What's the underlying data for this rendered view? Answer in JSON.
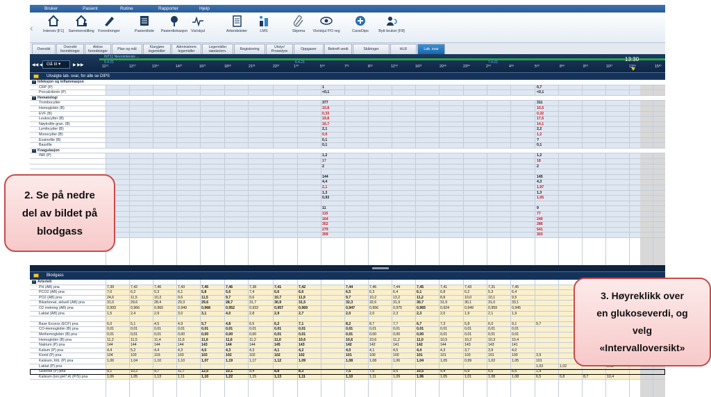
{
  "menu": [
    "Bruker",
    "Pasient",
    "Rutine",
    "Rapporter",
    "Hjelp"
  ],
  "toolbar": [
    "Intensiv [F1]",
    "Sammenstilling",
    "Forordninger",
    "Pasientliste",
    "Pasientlokasjon",
    "Vis/skjul",
    "Arbeidslister",
    "LMS",
    "Skjema",
    "Vis/skjul PO reg",
    "CaveDips",
    "Bytt bruker [F8]"
  ],
  "tabs": [
    "Oversikt",
    "Oversikt forordninger",
    "Aktive forordninger",
    "Plan og mål",
    "Klargjøre legemidler",
    "Administrere legemidler",
    "Legemidler væske/ern.",
    "Registrering",
    "Utstyr/ Prosedyre",
    "Oppgaver",
    "Bekreft verdi",
    "Skåringer",
    "HLR",
    "Lab. svar"
  ],
  "timeline": {
    "goto": "Gå til",
    "ward": "INT11 Nevrointensiv ...",
    "now": "13:30",
    "date1": "5.4.21",
    "date2": "6.4.21",
    "date3": "7.4.21",
    "ticks": [
      "11⁵¹",
      "12⁰⁷",
      "13¹⁴",
      "14³⁷",
      "16²⁷",
      "18²⁸",
      "21²³",
      "23³⁷",
      "1⁴⁰",
      "5⁰⁰",
      "7⁰¹",
      "8⁵²",
      "12⁴²",
      "16²³",
      "20⁰⁶",
      "23³⁴",
      "2⁰⁰",
      "4⁵⁶",
      "5⁰⁰",
      "8⁰⁶",
      "8⁵⁰",
      "10¹⁷",
      "13⁰⁰",
      "15³⁰"
    ]
  },
  "upper": {
    "title": "Utvalgte lab. svar, for alle se DIPS",
    "rows": [
      {
        "name": "Infeksjon og inflammasjon",
        "group": true
      },
      {
        "name": "CRP (P)",
        "a": "1",
        "b": "0,7"
      },
      {
        "name": "Procalcitonin (P)",
        "a": "<0,1",
        "b": "<0,1"
      },
      {
        "name": "Hematologi",
        "group": true
      },
      {
        "name": "Trombocytter",
        "a": "377",
        "b": "311"
      },
      {
        "name": "Hemoglobin (B)",
        "a": "10,8",
        "b": "10,5",
        "red": true
      },
      {
        "name": "EVF (B)",
        "a": "0,33",
        "b": "0,32",
        "red": true
      },
      {
        "name": "Leukocytter (B)",
        "a": "19,8",
        "b": "17,5",
        "red": true
      },
      {
        "name": "Nøytrofile gran. (B)",
        "a": "16,7",
        "b": "14,1",
        "red": true
      },
      {
        "name": "Lymfocytter (B)",
        "a": "2,1",
        "b": "2,2"
      },
      {
        "name": "Monocytter (B)",
        "a": "0,9",
        "b": "1,2",
        "red": true
      },
      {
        "name": "Eosinofile (B)",
        "a": "0,1",
        "b": "?"
      },
      {
        "name": "Basofile",
        "a": "0,1",
        "b": "0,1"
      },
      {
        "name": "Koagulasjon",
        "group": true
      },
      {
        "name": "INR (P)",
        "a": "1,2",
        "b": "1,2"
      },
      {
        "name": "",
        "a": "17",
        "b": "18",
        "red": true
      },
      {
        "name": "",
        "a": "2",
        "b": "2"
      },
      {
        "name": "",
        "a": "",
        "b": ""
      },
      {
        "name": "",
        "a": "144",
        "b": "145"
      },
      {
        "name": "",
        "a": "4,4",
        "b": "4,3"
      },
      {
        "name": "",
        "a": "2,1",
        "b": "1,97",
        "red": true
      },
      {
        "name": "",
        "a": "1,3",
        "b": "1,3"
      },
      {
        "name": "",
        "a": "0,93",
        "b": "1,05",
        "redb": true
      },
      {
        "name": "",
        "a": "",
        "b": ""
      },
      {
        "name": "",
        "a": "11",
        "b": "9"
      },
      {
        "name": "",
        "a": "115",
        "b": "77",
        "red": true
      },
      {
        "name": "",
        "a": "164",
        "b": "240",
        "red": true
      },
      {
        "name": "",
        "a": "352",
        "b": "286",
        "red": true
      },
      {
        "name": "(P)",
        "a": "279",
        "b": "541",
        "red": true
      },
      {
        "name": "Pankreasamylase (P)",
        "a": "359",
        "b": "303",
        "red": true
      }
    ]
  },
  "bloodgas": {
    "title": "Blodgass",
    "rows": [
      {
        "name": "Arterielt",
        "group": true
      },
      {
        "name": "PH (AB) pna",
        "v": [
          "7,39",
          "7,42",
          "7,46",
          "7,43",
          "7,45",
          "7,46",
          "7,38",
          "7,41",
          "7,42",
          "",
          "7,44",
          "7,46",
          "7,44",
          "7,45",
          "7,41",
          "7,43",
          "7,31",
          "7,45"
        ]
      },
      {
        "name": "PCO2 (AB) pna",
        "v": [
          "7,0",
          "6,2",
          "5,3",
          "6,1",
          "5,8",
          "5,6",
          "7,4",
          "6,6",
          "6,6",
          "",
          "6,5",
          "6,3",
          "6,4",
          "6,1",
          "6,8",
          "6,2",
          "5,3",
          "6,4"
        ]
      },
      {
        "name": "PO2 (AB) pna",
        "v": [
          "24,6",
          "11,5",
          "10,3",
          "9,6",
          "11,5",
          "9,7",
          "9,6",
          "10,7",
          "11,9",
          "",
          "9,7",
          "10,2",
          "13,2",
          "11,2",
          "8,8",
          "10,0",
          "10,1",
          "9,5"
        ]
      },
      {
        "name": "Bikarbonat, aktuell (AB) pna",
        "v": [
          "31,0",
          "29,6",
          "28,4",
          "29,3",
          "29,6",
          "28,7",
          "31,7",
          "30,9",
          "31,5",
          "",
          "32,3",
          "32,6",
          "31,9",
          "30,7",
          "31,9",
          "30,1",
          "31,0",
          "33,1"
        ]
      },
      {
        "name": "O2 metning (AB) pna",
        "v": [
          "0,993",
          "0,966",
          "0,960",
          "0,949",
          "0,968",
          "0,952",
          "0,933",
          "0,957",
          "0,969",
          "",
          "0,947",
          "0,956",
          "0,975",
          "0,965",
          "0,924",
          "0,949",
          "0,959",
          "0,945"
        ]
      },
      {
        "name": "Laktat (AB) pna",
        "v": [
          "1,5",
          "2,4",
          "2,9",
          "3,0",
          "3,1",
          "4,0",
          "2,8",
          "2,9",
          "2,7",
          "",
          "2,0",
          "2,0",
          "2,3",
          "2,3",
          "2,0",
          "1,9",
          "2,1",
          "1,9"
        ]
      },
      {
        "name": "",
        "v": []
      },
      {
        "name": "Base Excess (ECF) pna",
        "v": [
          "6,0",
          "5,1",
          "4,5",
          "4,9",
          "5,7",
          "4,8",
          "6,5",
          "6,2",
          "7,1",
          "",
          "8,2",
          "8,7",
          "7,7",
          "6,7",
          "7,3",
          "5,8",
          "6,0",
          "9,1"
        ]
      },
      {
        "name": "CO-Hemoglobin (B) pna",
        "v": [
          "0,01",
          "0,01",
          "0,01",
          "0,01",
          "0,01",
          "0,01",
          "0,01",
          "0,01",
          "0,01",
          "",
          "0,01",
          "0,01",
          "0,01",
          "0,01",
          "0,01",
          "0,01",
          "0,01",
          "0,01"
        ]
      },
      {
        "name": "Methemoglobin (B) pna",
        "v": [
          "0,01",
          "0,01",
          "0,01",
          "0,00",
          "0,00",
          "0,00",
          "0,00",
          "0,01",
          "0,01",
          "",
          "0,01",
          "0,00",
          "0,00",
          "0,00",
          "0,01",
          "0,01",
          "0,01",
          "0,01"
        ]
      },
      {
        "name": "Hemoglobin (B) pna",
        "v": [
          "11,2",
          "11,5",
          "11,4",
          "11,6",
          "11,6",
          "11,6",
          "11,2",
          "11,0",
          "10,6",
          "",
          "10,6",
          "10,6",
          "11,2",
          "11,0",
          "10,5",
          "10,2",
          "10,3",
          "10,4"
        ]
      },
      {
        "name": "Natrium (P) pna",
        "v": [
          "144",
          "144",
          "144",
          "144",
          "143",
          "144",
          "144",
          "145",
          "143",
          "",
          "142",
          "142",
          "141",
          "142",
          "144",
          "143",
          "143",
          "141"
        ]
      },
      {
        "name": "Kalium (P) pna",
        "v": [
          "4,4",
          "5,2",
          "4,4",
          "4,3",
          "4,5",
          "4,3",
          "4,3",
          "4,1",
          "4,2",
          "",
          "4,0",
          "4,1",
          "4,5",
          "4,4",
          "4,3",
          "3,7",
          "3,9",
          "4,0"
        ]
      },
      {
        "name": "Klorid (P) pna",
        "v": [
          "104",
          "103",
          "103",
          "103",
          "103",
          "102",
          "102",
          "102",
          "102",
          "",
          "101",
          "100",
          "100",
          "101",
          "101",
          "103",
          "101",
          "100"
        ]
      },
      {
        "name": "Kalsium, fritt, (P) pna",
        "v": [
          "1,06",
          "1,04",
          "1,10",
          "1,10",
          "1,07",
          "1,19",
          "1,17",
          "1,12",
          "1,09",
          "",
          "1,08",
          "1,08",
          "1,06",
          "1,04",
          "1,05",
          "0,99",
          "1,02",
          "1,05"
        ]
      },
      {
        "name": "Laktat (P) pna",
        "v": []
      },
      {
        "name": "Glukose (P) pna",
        "v": [
          "9,1",
          "10,2",
          "9,7",
          "11,7",
          "12,5",
          "10,1",
          "9,4",
          "8,8",
          "8,3",
          "",
          "7,5",
          "7,0",
          "9,5",
          "10,5",
          "9,4",
          "6,9",
          "5,5",
          "6,5"
        ]
      },
      {
        "name": "Kalsium (ion;pH7,4) (P/S) pna",
        "v": [
          "1,06",
          "1,05",
          "1,13",
          "1,11",
          "1,10",
          "1,22",
          "1,15",
          "1,13",
          "1,11",
          "",
          "1,10",
          "1,11",
          "1,09",
          "1,06",
          "1,05",
          "1,01",
          "1,08",
          "1,08"
        ]
      }
    ],
    "rightcols": {
      "c1": [
        "",
        "",
        "",
        "",
        "",
        "",
        "",
        "9,7",
        "",
        "",
        "",
        "",
        "",
        "3,9",
        "101",
        "1,03",
        "1,9",
        "6,5",
        "1,05"
      ],
      "c2": [
        "",
        "",
        "",
        "",
        "",
        "",
        "",
        "",
        "",
        "",
        "",
        "",
        "",
        "",
        "",
        "1,02",
        "",
        "6,8",
        "1,05"
      ],
      "c3": [
        "",
        "",
        "",
        "",
        "",
        "",
        "",
        "",
        "",
        "",
        "",
        "",
        "",
        "",
        "",
        "",
        "",
        "8,7",
        "1,10"
      ],
      "c4": [
        "",
        "",
        "",
        "",
        "",
        "",
        "",
        "",
        "",
        "",
        "",
        "",
        "",
        "",
        "",
        "1,02",
        "",
        "10,4",
        "1,04"
      ]
    }
  },
  "callouts": {
    "left": [
      "2. Se på nedre",
      "del av bildet på",
      "blodgass"
    ],
    "right": [
      "3. Høyreklikk over",
      "en glukoseverdi, og",
      "velg",
      "«Intervalloversikt»"
    ]
  }
}
